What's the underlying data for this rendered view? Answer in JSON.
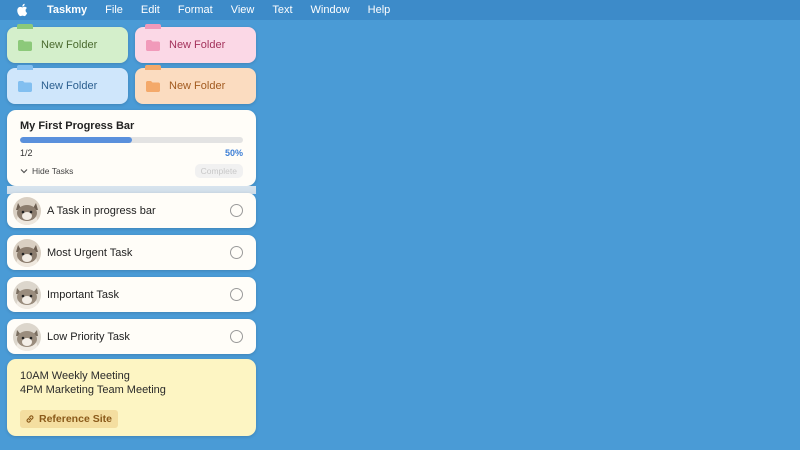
{
  "menubar": {
    "apple_icon": "apple-icon",
    "app_name": "Taskmy",
    "items": [
      "File",
      "Edit",
      "Format",
      "View",
      "Text",
      "Window",
      "Help"
    ]
  },
  "folders": [
    {
      "label": "New Folder",
      "color": "#d4efcb",
      "icon_color": "#8cc97a",
      "text_color": "#4a6a2e"
    },
    {
      "label": "New Folder",
      "color": "#fbd8e6",
      "icon_color": "#f19aba",
      "text_color": "#a3325b"
    },
    {
      "label": "New Folder",
      "color": "#cfe6fb",
      "icon_color": "#82bff0",
      "text_color": "#2b5f8f"
    },
    {
      "label": "New Folder",
      "color": "#fbdcc0",
      "icon_color": "#f4a96a",
      "text_color": "#a25a1f"
    }
  ],
  "progress": {
    "title": "My First Progress Bar",
    "fraction": 0.5,
    "count": "1/2",
    "percent": "50%",
    "hide_tasks": "Hide Tasks",
    "complete": "Complete"
  },
  "tasks": [
    {
      "label": "A Task in progress bar"
    },
    {
      "label": "Most Urgent Task"
    },
    {
      "label": "Important Task"
    },
    {
      "label": "Low Priority Task"
    }
  ],
  "note": {
    "line1": "10AM Weekly Meeting",
    "line2": "4PM Marketing Team Meeting",
    "link": "Reference Site"
  }
}
